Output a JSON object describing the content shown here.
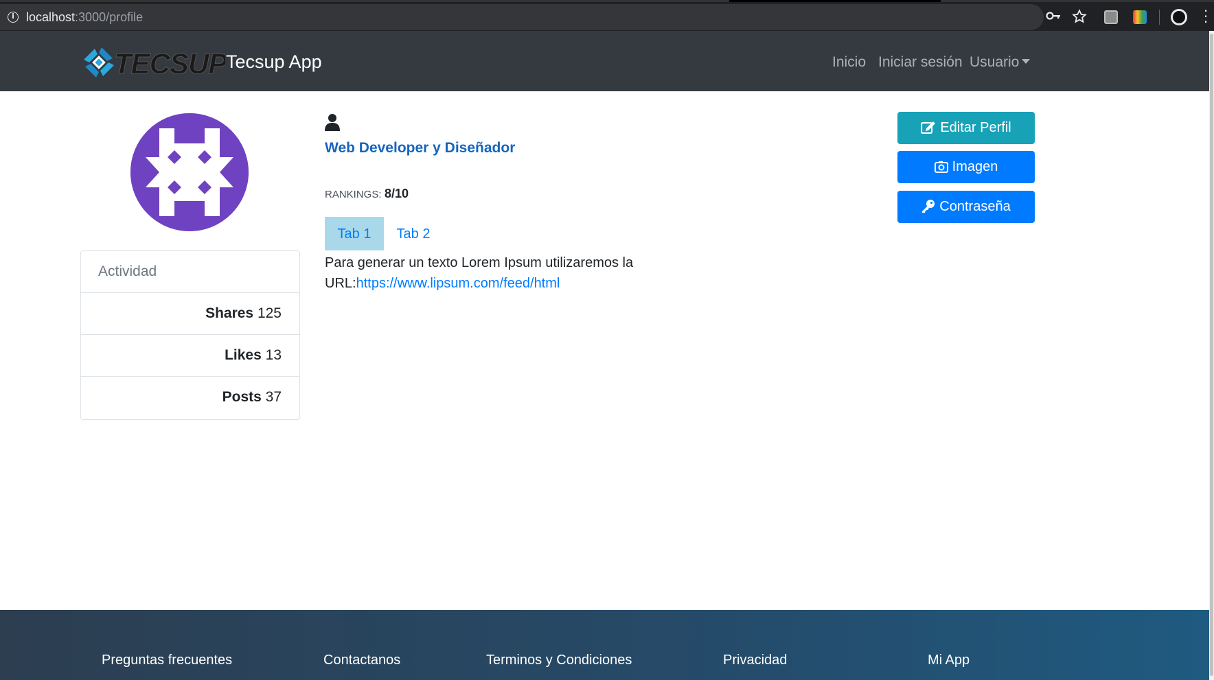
{
  "browser": {
    "url_host": "localhost",
    "url_path": ":3000/profile"
  },
  "navbar": {
    "brand_logo_text": "TECSUP",
    "brand_title": "Tecsup App",
    "links": [
      {
        "label": "Inicio"
      },
      {
        "label": "Iniciar sesión"
      },
      {
        "label": "Usuario"
      }
    ]
  },
  "activity": {
    "title": "Actividad",
    "stats": [
      {
        "label": "Shares",
        "value": "125"
      },
      {
        "label": "Likes",
        "value": "13"
      },
      {
        "label": "Posts",
        "value": "37"
      }
    ]
  },
  "profile": {
    "role": "Web Developer y Diseñador",
    "rankings_label": "RANKINGS:",
    "rankings_value": "8/10",
    "tabs": [
      {
        "label": "Tab 1",
        "active": true
      },
      {
        "label": "Tab 2",
        "active": false
      }
    ],
    "text": "Para generar un texto Lorem Ipsum utilizaremos la URL:",
    "link": "https://www.lipsum.com/feed/html"
  },
  "actions": {
    "edit_label": "Editar Perfil",
    "image_label": "Imagen",
    "password_label": "Contraseña"
  },
  "footer": {
    "links": [
      {
        "label": "Preguntas frecuentes"
      },
      {
        "label": "Contactanos"
      },
      {
        "label": "Terminos y Condiciones"
      },
      {
        "label": "Privacidad"
      },
      {
        "label": "Mi App"
      }
    ]
  },
  "colors": {
    "navbar": "#343a40",
    "avatar": "#6f42c1",
    "edit_button": "#17a2b8",
    "primary_button": "#007bff",
    "active_tab": "#a8d8ea"
  }
}
